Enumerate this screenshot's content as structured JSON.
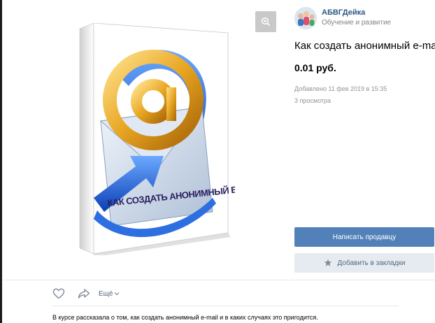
{
  "seller": {
    "name": "АБВГДейка",
    "subtitle": "Обучение и развитие"
  },
  "product": {
    "title": "Как создать анонимный e-mail",
    "price": "0.01 руб.",
    "added": "Добавлено 11 фев 2019 в 15:35",
    "views": "3 просмотра",
    "cover_text": "КАК СОЗДАТЬ АНОНИМНЫЙ E-MAIL"
  },
  "buttons": {
    "contact_seller": "Написать продавцу",
    "bookmark": "Добавить в закладки"
  },
  "actions": {
    "more": "Ещё"
  },
  "description": "В курсе рассказала о том, как создать анонимный e-mail и в каких случаях это пригодится.",
  "icons": {
    "zoom": "zoom-in-icon",
    "like": "heart-icon",
    "share": "share-icon",
    "bookmark": "star-icon",
    "more": "chevron-down-icon"
  },
  "colors": {
    "accent": "#5181b8",
    "link": "#2a5885",
    "secondary_button": "#e5ebf1"
  }
}
